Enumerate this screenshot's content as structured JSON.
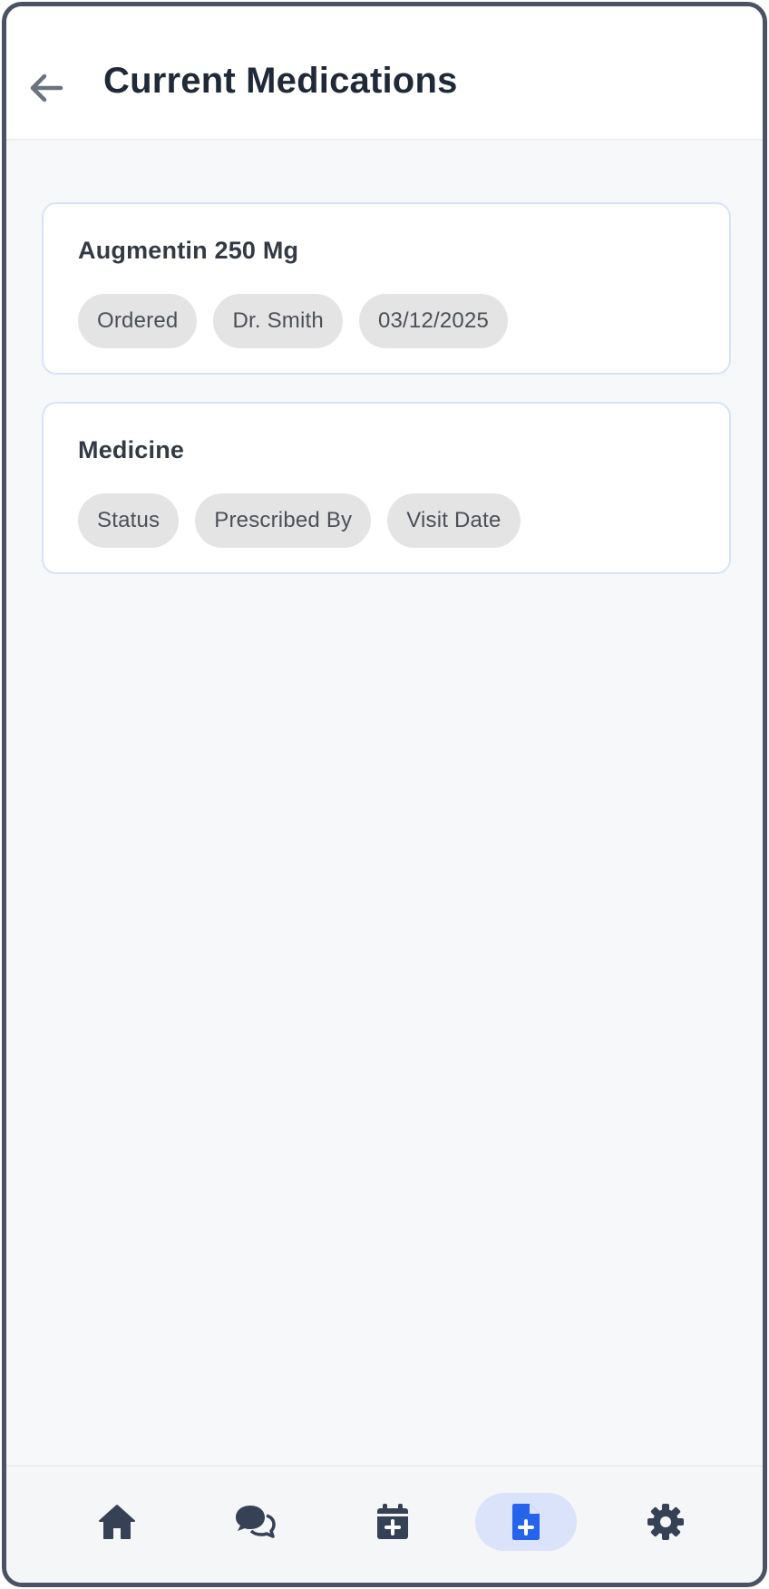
{
  "header": {
    "title": "Current Medications"
  },
  "medications": [
    {
      "name": "Augmentin 250 Mg",
      "status": "Ordered",
      "prescribed_by": "Dr. Smith",
      "visit_date": "03/12/2025"
    },
    {
      "name": "Medicine",
      "status": "Status",
      "prescribed_by": "Prescribed By",
      "visit_date": "Visit Date"
    }
  ],
  "bottom_nav": {
    "items": [
      {
        "icon": "home-icon",
        "active": false
      },
      {
        "icon": "chat-icon",
        "active": false
      },
      {
        "icon": "calendar-plus-icon",
        "active": false
      },
      {
        "icon": "medical-file-icon",
        "active": true
      },
      {
        "icon": "gear-icon",
        "active": false
      }
    ]
  },
  "colors": {
    "title": "#1f2937",
    "icon": "#374155",
    "active_icon": "#2563eb",
    "active_bg": "#dbe3fb",
    "chip_bg": "#e4e4e4",
    "card_border": "#d8e4f4",
    "frame": "#4a5263"
  }
}
